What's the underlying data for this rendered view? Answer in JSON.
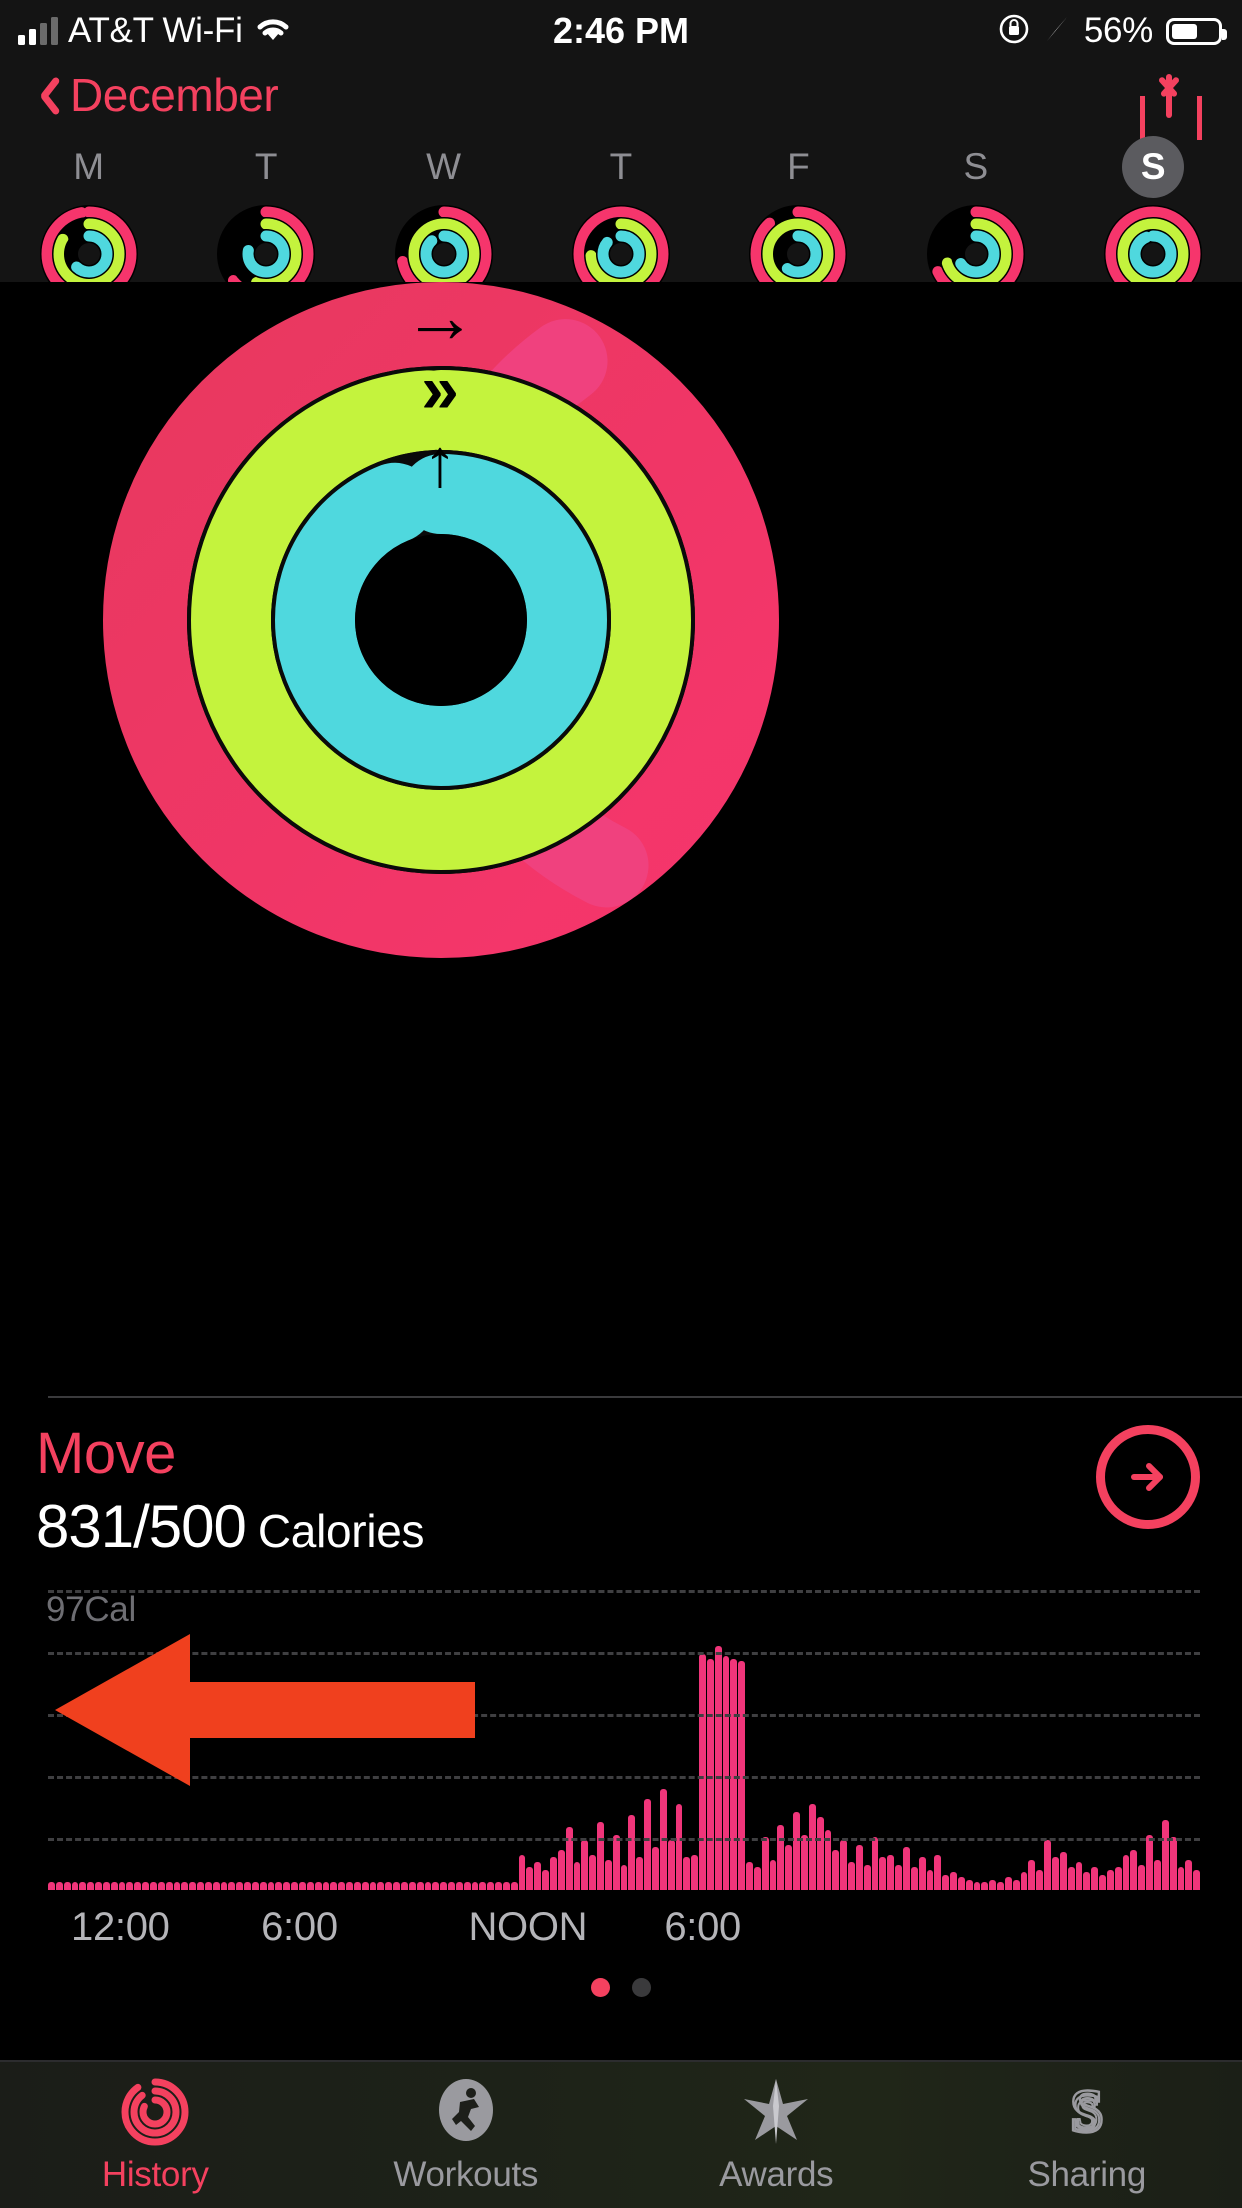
{
  "status_bar": {
    "carrier": "AT&T Wi-Fi",
    "time": "2:46 PM",
    "battery_percent": "56%",
    "signal_icon": "cellular-bars-icon",
    "wifi_icon": "wifi-icon",
    "rotation_lock_icon": "rotation-lock-icon",
    "location_icon": "location-arrow-icon",
    "battery_icon": "battery-icon"
  },
  "nav": {
    "back_label": "December",
    "back_icon": "chevron-left-icon",
    "share_icon": "share-icon",
    "accent": "#F4415F"
  },
  "week": {
    "days": [
      {
        "letter": "M",
        "selected": false,
        "move_pct": 97,
        "exercise_pct": 83,
        "stand_pct": 62
      },
      {
        "letter": "T",
        "selected": false,
        "move_pct": 64,
        "exercise_pct": 55,
        "stand_pct": 78
      },
      {
        "letter": "T2",
        "letter_display": "W",
        "selected": false,
        "move_pct": 72,
        "exercise_pct": 100,
        "stand_pct": 88
      },
      {
        "letter": "T",
        "selected": false,
        "move_pct": 100,
        "exercise_pct": 74,
        "stand_pct": 86
      },
      {
        "letter": "F",
        "selected": false,
        "move_pct": 88,
        "exercise_pct": 100,
        "stand_pct": 60
      },
      {
        "letter": "S",
        "selected": false,
        "move_pct": 68,
        "exercise_pct": 70,
        "stand_pct": 66
      },
      {
        "letter": "S",
        "selected": true,
        "move_pct": 166,
        "exercise_pct": 100,
        "stand_pct": 94
      }
    ]
  },
  "rings": {
    "move_icon": "arrow-right-icon",
    "exercise_icon": "double-chevron-right-icon",
    "stand_icon": "arrow-up-icon",
    "move_color": "#F6356C",
    "exercise_color": "#C4F33D",
    "stand_color": "#4FD8DE",
    "move_pct": 166,
    "exercise_pct": 100,
    "stand_pct": 94
  },
  "move_section": {
    "title": "Move",
    "value": "831/500",
    "units": "Calories",
    "detail_icon": "arrow-right-circle-icon",
    "color": "#F4415F"
  },
  "chart_data": {
    "type": "bar",
    "title": "Move",
    "ylabel": "97Cal",
    "peak_label": "97Cal",
    "xlabel": "",
    "grid": true,
    "gridlines": 5,
    "bar_color": "#F0357A",
    "ylim": [
      0,
      97
    ],
    "xtick_labels": [
      "12:00",
      "6:00",
      "NOON",
      "6:00"
    ],
    "xtick_positions_pct": [
      2,
      18.5,
      36.5,
      53.5
    ],
    "categories": [
      "12:00AM",
      "",
      "",
      "",
      "",
      "",
      "",
      "",
      "",
      "",
      "",
      "",
      "",
      "",
      "",
      "",
      "",
      "",
      "",
      "",
      "",
      "",
      "",
      "",
      "6:00AM",
      "",
      "",
      "",
      "",
      "",
      "",
      "",
      "",
      "",
      "",
      "",
      "NOON",
      "",
      "",
      "",
      "",
      "",
      "",
      "",
      "",
      "",
      "",
      "",
      "6:00PM",
      "",
      "",
      "",
      "",
      "",
      "",
      "",
      "",
      "",
      "",
      ""
    ],
    "values": [
      3,
      3,
      3,
      3,
      3,
      3,
      3,
      3,
      3,
      3,
      3,
      3,
      3,
      3,
      3,
      3,
      3,
      3,
      3,
      3,
      3,
      3,
      3,
      3,
      3,
      3,
      3,
      3,
      3,
      3,
      3,
      3,
      3,
      3,
      3,
      3,
      3,
      3,
      3,
      3,
      3,
      3,
      3,
      3,
      3,
      3,
      3,
      3,
      3,
      3,
      3,
      3,
      3,
      3,
      3,
      3,
      3,
      3,
      3,
      3,
      14,
      9,
      11,
      8,
      13,
      16,
      25,
      11,
      20,
      14,
      27,
      12,
      22,
      10,
      30,
      13,
      36,
      17,
      40,
      20,
      34,
      13,
      14,
      94,
      92,
      97,
      93,
      92,
      91,
      11,
      9,
      21,
      12,
      26,
      18,
      31,
      22,
      34,
      29,
      24,
      16,
      20,
      11,
      18,
      10,
      21,
      13,
      14,
      10,
      17,
      9,
      13,
      8,
      14,
      6,
      7,
      5,
      4,
      3,
      3,
      4,
      3,
      5,
      4,
      7,
      12,
      8,
      20,
      13,
      15,
      9,
      11,
      7,
      9,
      6,
      8,
      9,
      14,
      16,
      10,
      22,
      12,
      28,
      21,
      9,
      12,
      8
    ]
  },
  "page_dots": {
    "count": 2,
    "active_index": 0
  },
  "annotation": {
    "type": "left-arrow-overlay",
    "color": "#F0401E"
  },
  "tabbar": {
    "tabs": [
      {
        "label": "History",
        "icon": "activity-rings-icon",
        "active": true
      },
      {
        "label": "Workouts",
        "icon": "running-person-icon",
        "active": false
      },
      {
        "label": "Awards",
        "icon": "star-award-icon",
        "active": false
      },
      {
        "label": "Sharing",
        "icon": "sharing-s-icon",
        "active": false
      }
    ]
  }
}
